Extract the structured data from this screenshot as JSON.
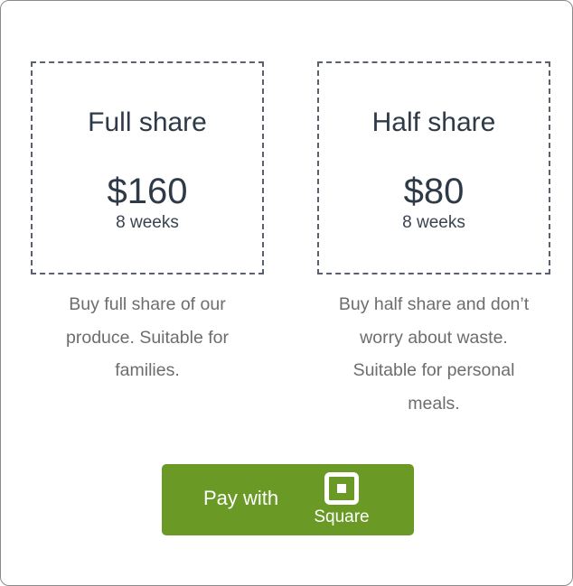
{
  "plans": [
    {
      "title": "Full share",
      "price": "$160",
      "period": "8 weeks",
      "description": [
        "Buy full share of our",
        "produce. Suitable for",
        "families."
      ]
    },
    {
      "title": "Half share",
      "price": "$80",
      "period": "8 weeks",
      "description": [
        "Buy half share and don’t",
        "worry about waste.",
        "Suitable for personal",
        "meals."
      ]
    }
  ],
  "payment": {
    "label": "Pay with",
    "brand": "Square",
    "button_color": "#6a9a25",
    "icon": "square-logo-icon"
  }
}
